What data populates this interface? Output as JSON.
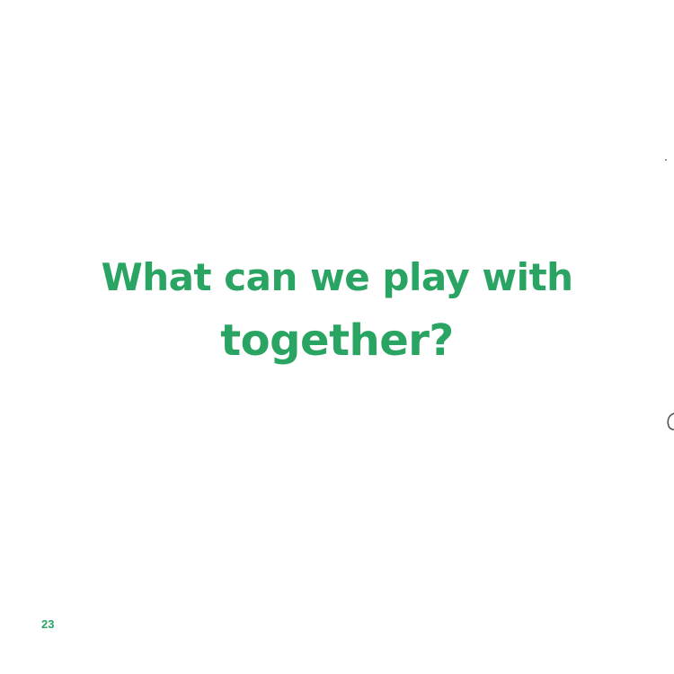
{
  "question": {
    "line1": "What can we play with",
    "line2": "together?"
  },
  "footer": {
    "page_number": "23"
  },
  "colors": {
    "text": "#2aa463",
    "background": "#ffffff"
  }
}
